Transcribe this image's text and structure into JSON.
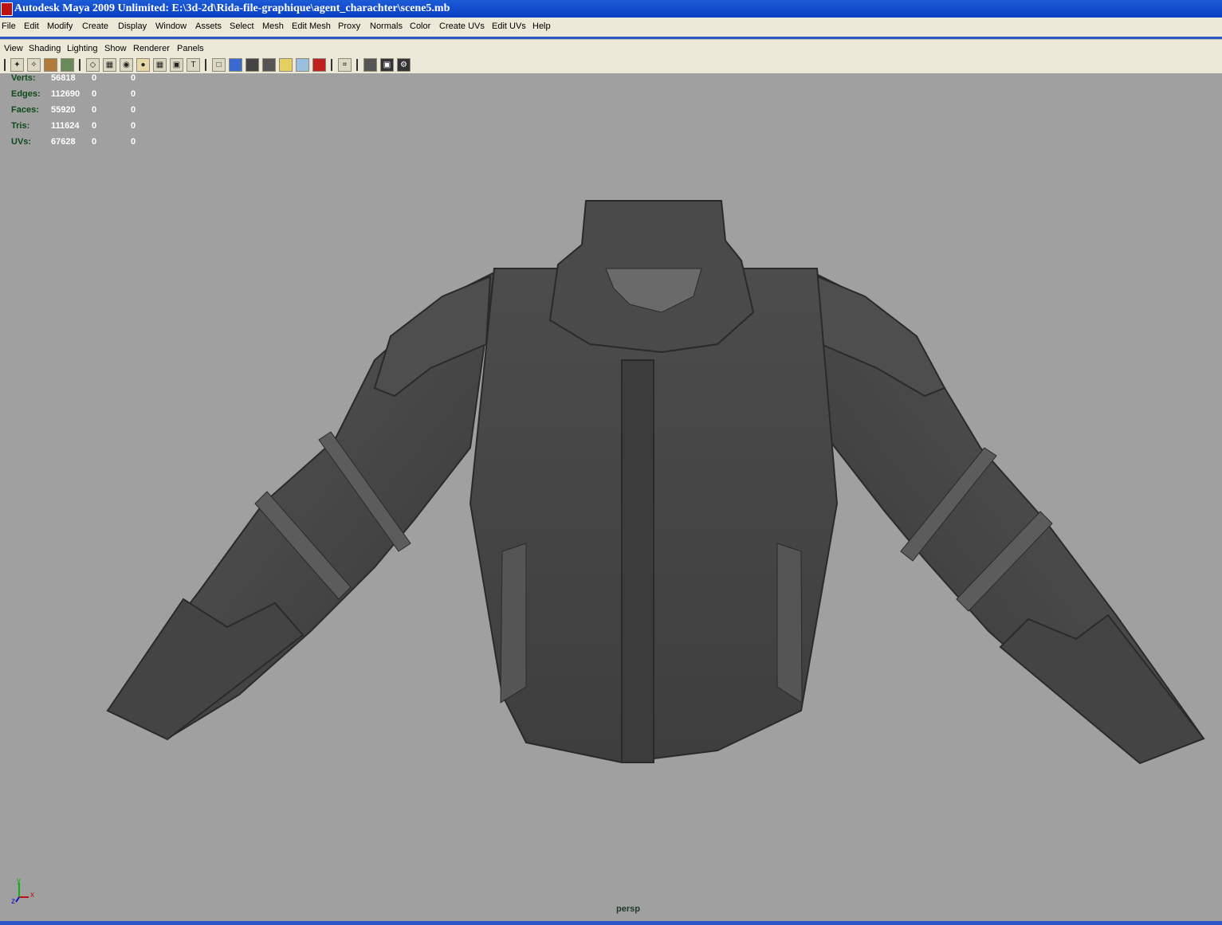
{
  "window": {
    "title": "Autodesk Maya 2009 Unlimited: E:\\3d-2d\\Rida-file-graphique\\agent_charachter\\scene5.mb"
  },
  "menubar": {
    "items": [
      "File",
      "Edit",
      "Modify",
      "Create",
      "Display",
      "Window",
      "Assets",
      "Select",
      "Mesh",
      "Edit Mesh",
      "Proxy",
      "Normals",
      "Color",
      "Create UVs",
      "Edit UVs",
      "Help"
    ]
  },
  "panel_menu": {
    "items": [
      "View",
      "Shading",
      "Lighting",
      "Show",
      "Renderer",
      "Panels"
    ]
  },
  "toolbar": {
    "icons": [
      "select-camera-icon",
      "lock-camera-icon",
      "bookmark-icon",
      "image-plane-icon",
      "layer-icon",
      "grid-icon",
      "film-gate-icon",
      "resolution-gate-icon",
      "safe-action-icon",
      "field-chart-icon",
      "wireframe-icon",
      "smooth-shade-icon",
      "flat-shade-icon",
      "bounding-box-icon",
      "light-icon",
      "texture-icon",
      "shadow-icon",
      "isolate-icon",
      "xray-icon",
      "frame-icon",
      "hud-icon"
    ]
  },
  "hud": {
    "rows": [
      {
        "label": "Verts:",
        "c1": "56818",
        "c2": "0",
        "c3": "0"
      },
      {
        "label": "Edges:",
        "c1": "112690",
        "c2": "0",
        "c3": "0"
      },
      {
        "label": "Faces:",
        "c1": "55920",
        "c2": "0",
        "c3": "0"
      },
      {
        "label": "Tris:",
        "c1": "111624",
        "c2": "0",
        "c3": "0"
      },
      {
        "label": "UVs:",
        "c1": "67628",
        "c2": "0",
        "c3": "0"
      }
    ]
  },
  "viewport": {
    "camera": "persp",
    "axis": {
      "x": "x",
      "y": "y",
      "z": "z"
    }
  },
  "colors": {
    "viewport_bg": "#a0a0a0",
    "hud_label": "#0e4a1a",
    "titlebar": "#0a3fc4",
    "menu_bg": "#ece9d8"
  }
}
